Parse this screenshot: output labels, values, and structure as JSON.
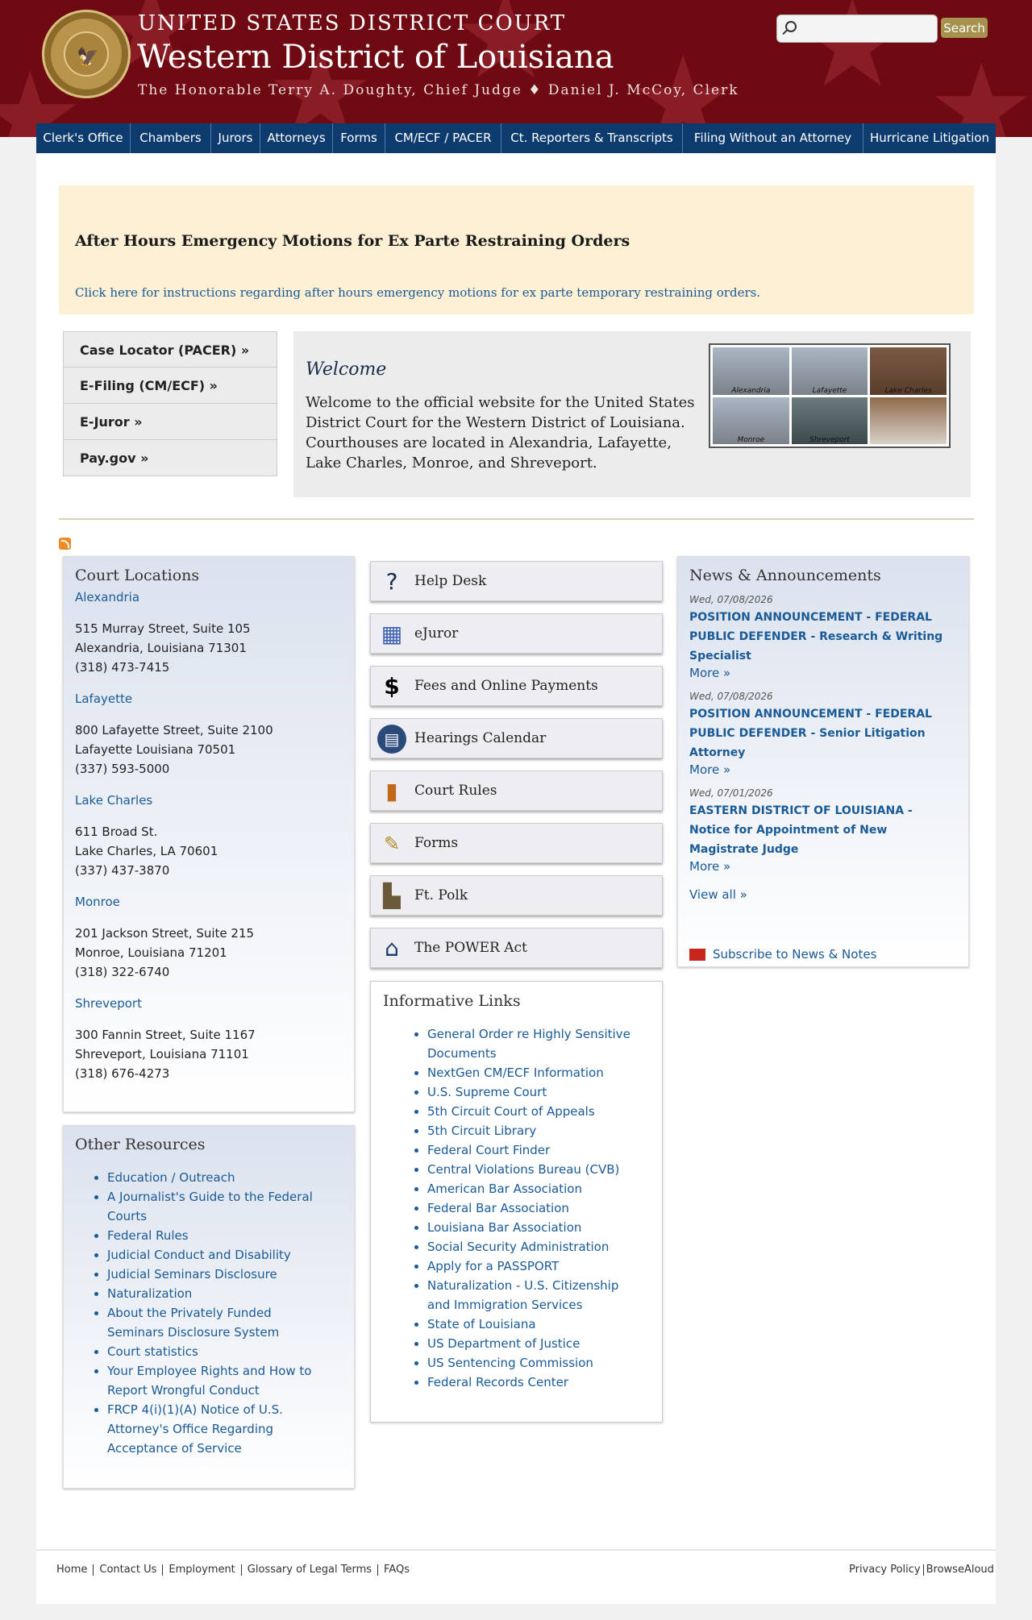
{
  "header": {
    "court": "UNITED STATES DISTRICT COURT",
    "district": "Western District of Louisiana",
    "judges": "The Honorable Terry A. Doughty, Chief Judge ♦ Daniel J. McCoy, Clerk",
    "search_placeholder": "",
    "search_button": "Search"
  },
  "nav": [
    "Clerk's Office",
    "Chambers",
    "Jurors",
    "Attorneys",
    "Forms",
    "CM/ECF / PACER",
    "Ct. Reporters & Transcripts",
    "Filing Without an Attorney",
    "Hurricane Litigation"
  ],
  "alert": {
    "title": "After Hours Emergency Motions for Ex Parte Restraining Orders",
    "link": "Click here for instructions regarding after hours emergency motions for ex parte temporary restraining orders."
  },
  "quick_links": [
    "Case Locator (PACER) »",
    "E-Filing (CM/ECF) »",
    "E-Juror »",
    "Pay.gov »"
  ],
  "welcome": {
    "title": "Welcome",
    "text": "Welcome to the official website for the United States District Court for the Western District of Louisiana. Courthouses are located in Alexandria, Lafayette, Lake Charles, Monroe, and Shreveport.",
    "image_labels": [
      "Alexandria",
      "Lafayette",
      "Lake Charles",
      "Monroe",
      "Shreveport",
      ""
    ]
  },
  "locations": {
    "title": "Court Locations",
    "items": [
      {
        "city": "Alexandria",
        "line1": "515 Murray Street, Suite 105",
        "line2": "Alexandria, Louisiana 71301",
        "phone": "(318) 473-7415"
      },
      {
        "city": "Lafayette",
        "line1": "800 Lafayette Street, Suite 2100",
        "line2": "Lafayette Louisiana 70501",
        "phone": "(337) 593-5000"
      },
      {
        "city": "Lake Charles",
        "line1": "611 Broad St.",
        "line2": "Lake Charles, LA 70601",
        "phone": "(337) 437-3870"
      },
      {
        "city": "Monroe",
        "line1": "201 Jackson Street, Suite 215",
        "line2": "Monroe, Louisiana 71201",
        "phone": "(318) 322-6740"
      },
      {
        "city": "Shreveport",
        "line1": "300 Fannin Street, Suite 1167",
        "line2": "Shreveport, Louisiana 71101",
        "phone": "(318) 676-4273"
      }
    ]
  },
  "other_resources": {
    "title": "Other Resources",
    "items": [
      "Education / Outreach",
      "A Journalist's Guide to the Federal Courts",
      "Federal Rules",
      "Judicial Conduct and Disability",
      "Judicial Seminars Disclosure",
      "Naturalization",
      "About the Privately Funded Seminars Disclosure System",
      "Court statistics",
      "Your Employee Rights and How to Report Wrongful Conduct",
      "FRCP 4(i)(1)(A) Notice of U.S. Attorney's Office Regarding Acceptance of Service"
    ]
  },
  "buttons": [
    {
      "label": "Help Desk",
      "icon": "help-desk-icon"
    },
    {
      "label": "eJuror",
      "icon": "ejuror-icon"
    },
    {
      "label": "Fees and Online Payments",
      "icon": "dollar-icon"
    },
    {
      "label": "Hearings Calendar",
      "icon": "calendar-icon"
    },
    {
      "label": "Court Rules",
      "icon": "book-icon"
    },
    {
      "label": "Forms",
      "icon": "forms-icon"
    },
    {
      "label": "Ft. Polk",
      "icon": "ft-polk-icon"
    },
    {
      "label": "The POWER Act",
      "icon": "capitol-icon"
    }
  ],
  "informative_links": {
    "title": "Informative Links",
    "items": [
      "General Order re Highly Sensitive Documents",
      "NextGen CM/ECF Information",
      "U.S. Supreme Court",
      "5th Circuit Court of Appeals",
      "5th Circuit Library",
      "Federal Court Finder",
      "Central Violations Bureau (CVB)",
      "American Bar Association",
      "Federal Bar Association",
      "Louisiana Bar Association",
      "Social Security Administration",
      "Apply for a PASSPORT",
      "Naturalization - U.S. Citizenship and Immigration Services",
      "State of Louisiana",
      "US Department of Justice",
      "US Sentencing Commission",
      "Federal Records Center"
    ]
  },
  "news": {
    "title": "News & Announcements",
    "items": [
      {
        "date": "Wed, 07/08/2026",
        "title": "POSITION ANNOUNCEMENT - FEDERAL PUBLIC DEFENDER - Research & Writing Specialist",
        "more": "More »"
      },
      {
        "date": "Wed, 07/08/2026",
        "title": "POSITION ANNOUNCEMENT - FEDERAL PUBLIC DEFENDER - Senior Litigation Attorney",
        "more": "More »"
      },
      {
        "date": "Wed, 07/01/2026",
        "title": "EASTERN DISTRICT OF LOUISIANA - Notice for Appointment of New Magistrate Judge",
        "more": "More »"
      }
    ],
    "view_all": "View all »",
    "subscribe": "Subscribe to News & Notes"
  },
  "footer": {
    "left": [
      "Home",
      "Contact Us",
      "Employment",
      "Glossary of Legal Terms",
      "FAQs"
    ],
    "right": [
      "Privacy Policy",
      "BrowseAloud"
    ]
  },
  "colors": {
    "header": "#6f0a12",
    "nav": "#0d3b6e",
    "link": "#1a5a96",
    "alert_bg": "#fdf0d4",
    "search_button": "#a5924f"
  }
}
